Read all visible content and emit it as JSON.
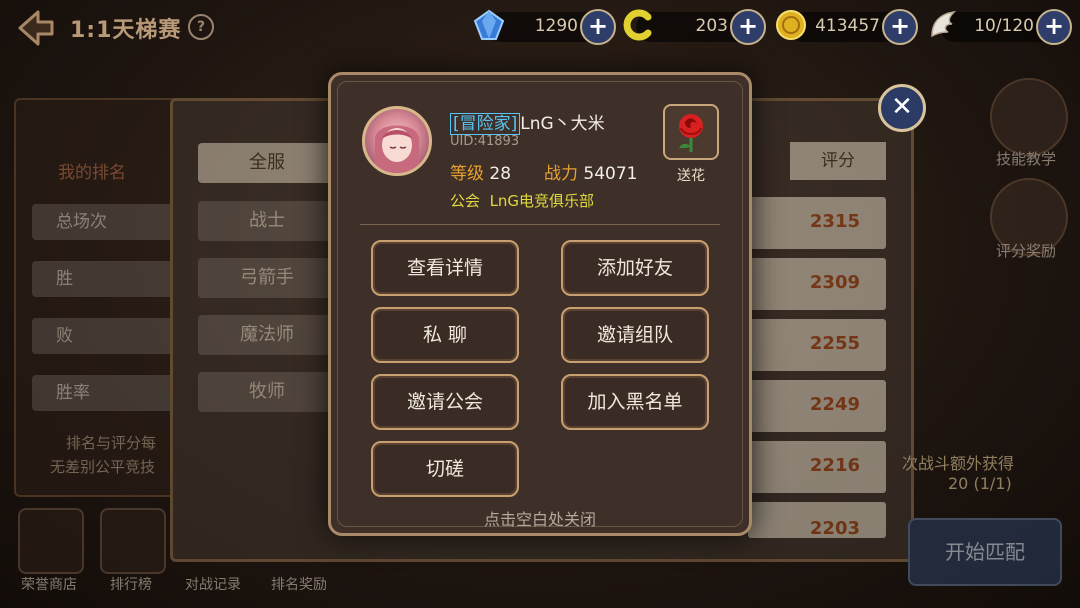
{
  "header": {
    "title": "1:1天梯赛",
    "help_glyph": "?",
    "resources": [
      {
        "name": "gem",
        "icon": "blue-gem-icon",
        "value": "1290"
      },
      {
        "name": "coin-c",
        "icon": "c-coin-icon",
        "value": "203"
      },
      {
        "name": "gold",
        "icon": "gold-coin-icon",
        "value": "413457"
      },
      {
        "name": "stamina",
        "icon": "wing-icon",
        "value": "10/120"
      }
    ]
  },
  "left_panel": {
    "heading": "我的排名",
    "stats": [
      "总场次",
      "胜",
      "败",
      "胜率"
    ],
    "note_line1": "排名与评分每",
    "note_line2": "无差别公平竞技"
  },
  "categories": [
    {
      "label": "全服",
      "active": true
    },
    {
      "label": "战士",
      "active": false
    },
    {
      "label": "弓箭手",
      "active": false
    },
    {
      "label": "魔法师",
      "active": false
    },
    {
      "label": "牧师",
      "active": false
    }
  ],
  "table": {
    "score_header": "评分",
    "scores": [
      "2315",
      "2309",
      "2255",
      "2249",
      "2216",
      "2203"
    ]
  },
  "side_buttons": [
    {
      "label": "技能教学",
      "icon": "tutorial-icon"
    },
    {
      "label": "评分奖励",
      "icon": "reward-icon"
    }
  ],
  "extra_reward": {
    "text": "次战斗额外获得",
    "count": "20 (1/1)"
  },
  "start_button": "开始匹配",
  "bottom_nav": [
    {
      "label": "荣誉商店",
      "icon": "shop-icon"
    },
    {
      "label": "排行榜",
      "icon": "trophy-icon"
    },
    {
      "label": "对战记录",
      "icon": "record-icon"
    },
    {
      "label": "排名奖励",
      "icon": "rank-reward-icon"
    }
  ],
  "close_glyph": "✕",
  "popup": {
    "player_tag": "[冒险家]",
    "player_name": "LnG丶大米",
    "uid": "UID:41893",
    "level_label": "等级",
    "level": "28",
    "power_label": "战力",
    "power": "54071",
    "guild_label": "公会",
    "guild_name": "LnG电竞俱乐部",
    "flower_label": "送花",
    "actions": {
      "view_details": "查看详情",
      "add_friend": "添加好友",
      "private_chat": "私 聊",
      "invite_team": "邀请组队",
      "invite_guild": "邀请公会",
      "blacklist": "加入黑名单",
      "spar": "切磋"
    },
    "close_hint": "点击空白处关闭"
  },
  "colors": {
    "accent_orange": "#e8a030",
    "tag_blue": "#56c4f4",
    "guild_yellow": "#e0d840",
    "score_red": "#a44a1c",
    "frame_gold": "#c8a070"
  }
}
